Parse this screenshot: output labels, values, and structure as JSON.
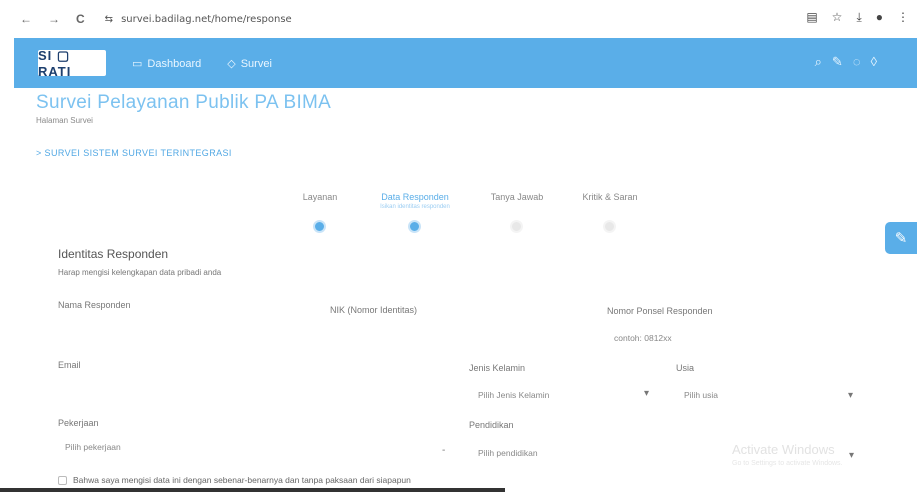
{
  "browser": {
    "back": "←",
    "forward": "→",
    "reload": "C",
    "url": "survei.badilag.net/home/response",
    "toolbar_icons": [
      "translate-icon",
      "star-icon",
      "download-icon",
      "profile-icon",
      "more-icon"
    ]
  },
  "app": {
    "logo_text": "SI ▢ RATI",
    "menu": [
      {
        "icon": "▭",
        "label": "Dashboard"
      },
      {
        "icon": "◇",
        "label": "Survei"
      }
    ]
  },
  "page": {
    "title": "Survei Pelayanan Publik PA BIMA",
    "subtitle": "Halaman Survei",
    "breadcrumb": "> SURVEI SISTEM SURVEI TERINTEGRASI"
  },
  "stepper": [
    {
      "label": "Layanan",
      "sub": "",
      "state": "done"
    },
    {
      "label": "Data Responden",
      "sub": "Isikan identitas responden",
      "state": "current"
    },
    {
      "label": "Tanya Jawab",
      "sub": "",
      "state": "pending"
    },
    {
      "label": "Kritik & Saran",
      "sub": "",
      "state": "pending"
    }
  ],
  "form": {
    "section_title": "Identitas Responden",
    "section_desc": "Harap mengisi kelengkapan data pribadi anda",
    "nama_label": "Nama Responden",
    "nik_label": "NIK (Nomor Identitas)",
    "hp_label": "Nomor Ponsel Responden",
    "hp_placeholder": "contoh: 0812xx",
    "email_label": "Email",
    "jk_label": "Jenis Kelamin",
    "jk_value": "Pilih Jenis Kelamin",
    "usia_label": "Usia",
    "usia_value": "Pilih usia",
    "pekerjaan_label": "Pekerjaan",
    "pekerjaan_value": "Pilih pekerjaan",
    "pendidikan_label": "Pendidikan",
    "pendidikan_value": "Pilih pendidikan",
    "agreement": "Bahwa saya mengisi data ini dengan sebenar-benarnya dan tanpa paksaan dari siapapun"
  },
  "watermark": {
    "line1": "Activate Windows",
    "line2": "Go to Settings to activate Windows."
  }
}
